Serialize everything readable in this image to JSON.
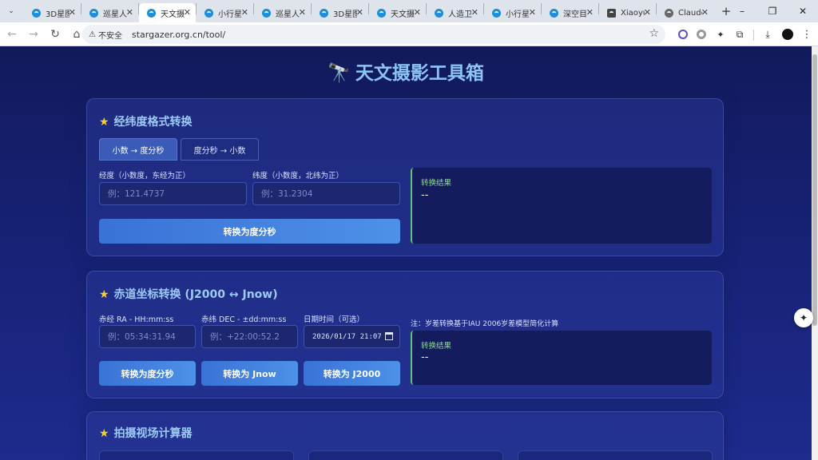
{
  "browser": {
    "tabs": [
      {
        "title": "3D星图",
        "icon": "site-favicon"
      },
      {
        "title": "巡星人",
        "icon": "site-favicon"
      },
      {
        "title": "天文摄",
        "icon": "site-favicon",
        "active": true
      },
      {
        "title": "小行星",
        "icon": "site-favicon"
      },
      {
        "title": "巡星人",
        "icon": "site-favicon"
      },
      {
        "title": "3D星图",
        "icon": "site-favicon"
      },
      {
        "title": "天文摄",
        "icon": "site-favicon"
      },
      {
        "title": "人造卫",
        "icon": "site-favicon"
      },
      {
        "title": "小行星",
        "icon": "site-favicon"
      },
      {
        "title": "深空目",
        "icon": "site-favicon"
      },
      {
        "title": "Xiaoyu",
        "icon": "as-favicon"
      },
      {
        "title": "Claude",
        "icon": "globe-favicon"
      }
    ],
    "security_label": "不安全",
    "url": "stargazer.org.cn/tool/"
  },
  "page": {
    "title": "天文摄影工具箱",
    "title_icon": "🔭"
  },
  "card1": {
    "title": "经纬度格式转换",
    "tab_active": "小数 → 度分秒",
    "tab_inactive": "度分秒 → 小数",
    "lon_label": "经度（小数度，东经为正）",
    "lon_placeholder": "例：121.4737",
    "lat_label": "纬度（小数度，北纬为正）",
    "lat_placeholder": "例：31.2304",
    "convert_button": "转换为度分秒",
    "result_label": "转换结果",
    "result_value": "--"
  },
  "card2": {
    "title": "赤道坐标转换 (J2000 ↔ Jnow)",
    "ra_label": "赤经 RA - HH:mm:ss",
    "ra_placeholder": "例：05:34:31.94",
    "dec_label": "赤纬 DEC - ±dd:mm:ss",
    "dec_placeholder": "例：+22:00:52.2",
    "date_label": "日期时间（可选）",
    "date_value": "2026/01/17  21:07",
    "note": "注：岁差转换基于IAU 2006岁差模型简化计算",
    "result_label": "转换结果",
    "result_value": "--",
    "btn_dms": "转换为度分秒",
    "btn_jnow": "转换为 Jnow",
    "btn_j2000": "转换为 J2000"
  },
  "card3": {
    "title": "拍摄视场计算器"
  }
}
